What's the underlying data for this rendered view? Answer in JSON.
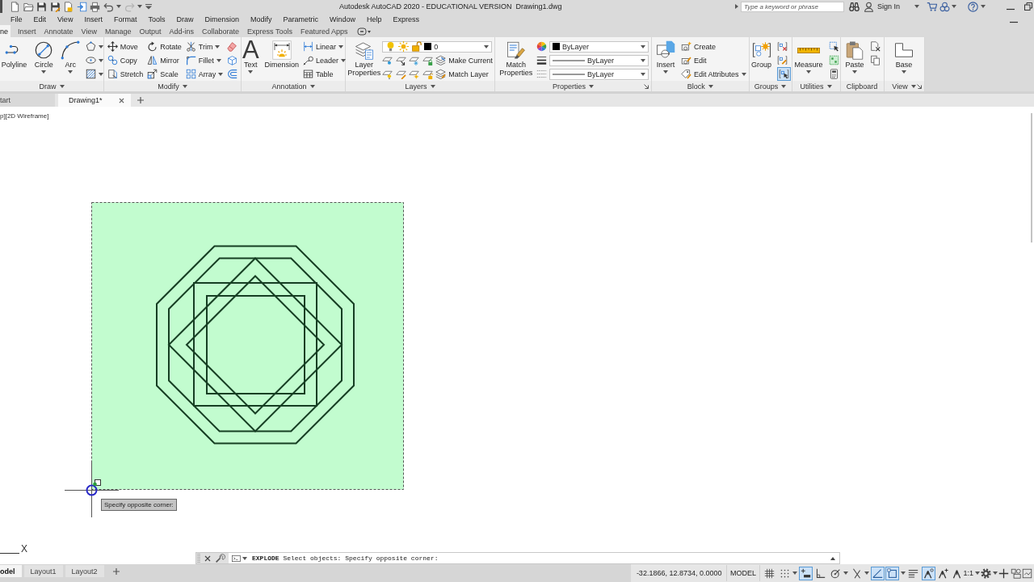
{
  "title_bar": {
    "app_title": "Autodesk AutoCAD 2020 - EDUCATIONAL VERSION",
    "file_name": "Drawing1.dwg",
    "search": {
      "placeholder": "Type a keyword or phrase"
    },
    "sign_in": "Sign In"
  },
  "menu_bar": [
    "File",
    "Edit",
    "View",
    "Insert",
    "Format",
    "Tools",
    "Draw",
    "Dimension",
    "Modify",
    "Parametric",
    "Window",
    "Help",
    "Express"
  ],
  "ribbon_tabs": [
    {
      "label": "ne",
      "selected": true
    },
    {
      "label": "Insert",
      "selected": false
    },
    {
      "label": "Annotate",
      "selected": false
    },
    {
      "label": "View",
      "selected": false
    },
    {
      "label": "Manage",
      "selected": false
    },
    {
      "label": "Output",
      "selected": false
    },
    {
      "label": "Add-ins",
      "selected": false
    },
    {
      "label": "Collaborate",
      "selected": false
    },
    {
      "label": "Express Tools",
      "selected": false
    },
    {
      "label": "Featured Apps",
      "selected": false
    }
  ],
  "ribbon_panels": [
    {
      "title": "Draw",
      "tools": [
        {
          "kind": "large",
          "label": "Polyline"
        },
        {
          "kind": "large",
          "label": "Circle"
        },
        {
          "kind": "large",
          "label": "Arc"
        }
      ]
    },
    {
      "title": "Modify",
      "tools": [
        {
          "kind": "small",
          "label": "Move"
        },
        {
          "kind": "small",
          "label": "Copy"
        },
        {
          "kind": "small",
          "label": "Stretch"
        },
        {
          "kind": "small",
          "label": "Rotate"
        },
        {
          "kind": "small",
          "label": "Mirror"
        },
        {
          "kind": "small",
          "label": "Scale"
        },
        {
          "kind": "small",
          "label": "Trim"
        },
        {
          "kind": "small",
          "label": "Fillet"
        },
        {
          "kind": "small",
          "label": "Array"
        }
      ]
    },
    {
      "title": "Annotation",
      "tools": [
        {
          "kind": "glyph",
          "glyph": "A",
          "label": "Text"
        },
        {
          "kind": "large",
          "label": "Dimension"
        },
        {
          "kind": "small",
          "label": "Linear"
        },
        {
          "kind": "small",
          "label": "Leader"
        },
        {
          "kind": "small",
          "label": "Table"
        }
      ]
    },
    {
      "title": "Layers",
      "tools": [
        {
          "kind": "large",
          "label": "Layer Properties"
        },
        {
          "kind": "dropdown",
          "value": "0"
        },
        {
          "kind": "small",
          "label": "Make Current"
        },
        {
          "kind": "small",
          "label": "Match Layer"
        }
      ]
    },
    {
      "title": "Properties",
      "tools": [
        {
          "kind": "large",
          "label": "Match Properties"
        },
        {
          "kind": "dropdown",
          "value": "ByLayer"
        },
        {
          "kind": "dropdown",
          "value": "ByLayer"
        },
        {
          "kind": "dropdown",
          "value": "ByLayer"
        }
      ]
    },
    {
      "title": "Block",
      "tools": [
        {
          "kind": "large",
          "label": "Insert"
        },
        {
          "kind": "small",
          "label": "Create"
        },
        {
          "kind": "small",
          "label": "Edit"
        },
        {
          "kind": "small",
          "label": "Edit Attributes"
        }
      ]
    },
    {
      "title": "Groups",
      "tools": [
        {
          "kind": "large",
          "label": "Group"
        },
        {
          "kind": "toggle",
          "on": true
        }
      ]
    },
    {
      "title": "Utilities",
      "tools": [
        {
          "kind": "large",
          "label": "Measure"
        }
      ]
    },
    {
      "title": "Clipboard",
      "tools": [
        {
          "kind": "large",
          "label": "Paste"
        }
      ]
    },
    {
      "title": "View",
      "tools": [
        {
          "kind": "large",
          "label": "Base"
        }
      ]
    }
  ],
  "file_tabs": [
    {
      "label": "tart",
      "selected": false
    },
    {
      "label": "Drawing1*",
      "selected": true
    }
  ],
  "viewport": {
    "label": "p][2D Wireframe]",
    "tooltip": "Specify opposite corner:",
    "ucs_axis": "X"
  },
  "command_line": {
    "text": "**EXPLODE** Select objects: Specify opposite corner:"
  },
  "layout_tabs": [
    {
      "label": "odel",
      "selected": true
    },
    {
      "label": "Layout1",
      "selected": false
    },
    {
      "label": "Layout2",
      "selected": false
    }
  ],
  "status_bar": {
    "coordinates": "-32.1866, 12.8734, 0.0000",
    "space": "MODEL",
    "toggles": [
      {
        "on": false
      },
      {
        "on": false
      },
      {
        "on": true
      },
      {
        "on": false
      },
      {
        "on": false
      },
      {
        "on": false
      },
      {
        "on": true
      },
      {
        "on": true
      },
      {
        "on": false
      },
      {
        "on": true
      },
      {
        "on": false
      }
    ],
    "scale": "1:1"
  }
}
